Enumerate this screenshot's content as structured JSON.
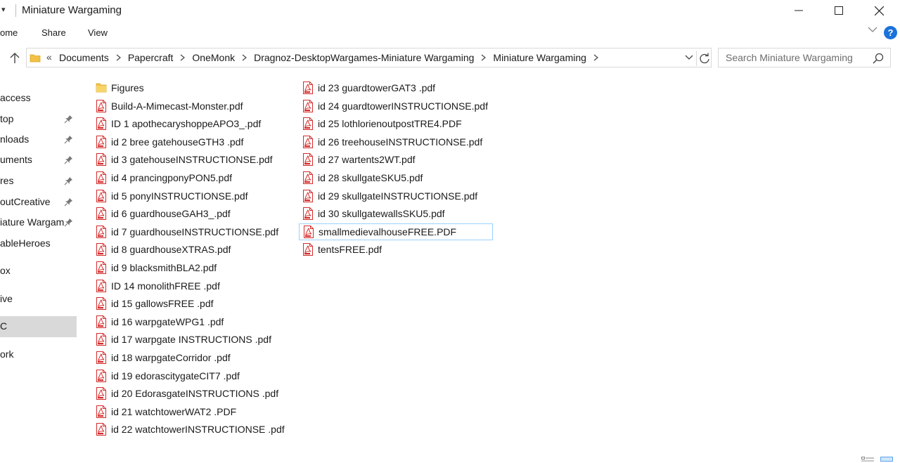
{
  "window": {
    "title": "Miniature Wargaming",
    "controls": [
      "minimize-icon",
      "maximize-icon",
      "close-icon"
    ]
  },
  "ribbon": {
    "tabs": [
      "ome",
      "Share",
      "View"
    ],
    "help_label": "?"
  },
  "address": {
    "overflow_label": "«",
    "breadcrumbs": [
      "Documents",
      "Papercraft",
      "OneMonk",
      "Dragnoz-DesktopWargames-Miniature Wargaming",
      "Miniature Wargaming"
    ]
  },
  "search": {
    "placeholder": "Search Miniature Wargaming"
  },
  "nav": {
    "items": [
      {
        "label": "access",
        "pinned": false
      },
      {
        "label": "top",
        "pinned": true
      },
      {
        "label": "nloads",
        "pinned": true
      },
      {
        "label": "uments",
        "pinned": true
      },
      {
        "label": "res",
        "pinned": true
      },
      {
        "label": "outCreative",
        "pinned": true
      },
      {
        "label": "iature Wargam",
        "pinned": true
      },
      {
        "label": "ableHeroes",
        "pinned": false
      },
      {
        "label": "ox",
        "pinned": false
      },
      {
        "label": "ive",
        "pinned": false
      },
      {
        "label": "C",
        "pinned": false,
        "selected": true
      },
      {
        "label": "ork",
        "pinned": false
      }
    ]
  },
  "files": {
    "column1": [
      {
        "name": "Figures",
        "type": "folder"
      },
      {
        "name": "Build-A-Mimecast-Monster.pdf",
        "type": "pdf"
      },
      {
        "name": "ID 1 apothecaryshoppeAPO3_.pdf",
        "type": "pdf"
      },
      {
        "name": "id 2 bree gatehouseGTH3 .pdf",
        "type": "pdf"
      },
      {
        "name": "id 3 gatehouseINSTRUCTIONSE.pdf",
        "type": "pdf"
      },
      {
        "name": "id 4 prancingponyPON5.pdf",
        "type": "pdf"
      },
      {
        "name": "id 5 ponyINSTRUCTIONSE.pdf",
        "type": "pdf"
      },
      {
        "name": "id 6 guardhouseGAH3_.pdf",
        "type": "pdf"
      },
      {
        "name": "id 7 guardhouseINSTRUCTIONSE.pdf",
        "type": "pdf"
      },
      {
        "name": "id 8 guardhouseXTRAS.pdf",
        "type": "pdf"
      },
      {
        "name": "id 9 blacksmithBLA2.pdf",
        "type": "pdf"
      },
      {
        "name": "ID 14 monolithFREE .pdf",
        "type": "pdf"
      },
      {
        "name": "id 15 gallowsFREE .pdf",
        "type": "pdf"
      },
      {
        "name": "id 16 warpgateWPG1 .pdf",
        "type": "pdf"
      },
      {
        "name": "id 17 warpgate INSTRUCTIONS .pdf",
        "type": "pdf"
      },
      {
        "name": "id 18 warpgateCorridor .pdf",
        "type": "pdf"
      },
      {
        "name": "id 19 edorascitygateCIT7 .pdf",
        "type": "pdf"
      },
      {
        "name": "id 20 EdorasgateINSTRUCTIONS .pdf",
        "type": "pdf"
      },
      {
        "name": "id 21 watchtowerWAT2 .PDF",
        "type": "pdf"
      },
      {
        "name": "id 22 watchtowerINSTRUCTIONSE .pdf",
        "type": "pdf"
      }
    ],
    "column2": [
      {
        "name": "id 23 guardtowerGAT3 .pdf",
        "type": "pdf"
      },
      {
        "name": "id 24 guardtowerINSTRUCTIONSE.pdf",
        "type": "pdf"
      },
      {
        "name": "id 25 lothlorienoutpostTRE4.PDF",
        "type": "pdf"
      },
      {
        "name": "id 26 treehouseINSTRUCTIONSE.pdf",
        "type": "pdf"
      },
      {
        "name": "id 27 wartents2WT.pdf",
        "type": "pdf"
      },
      {
        "name": "id 28 skullgateSKU5.pdf",
        "type": "pdf"
      },
      {
        "name": "id 29 skullgateINSTRUCTIONSE.pdf",
        "type": "pdf"
      },
      {
        "name": "id 30 skullgatewallsSKU5.pdf",
        "type": "pdf"
      },
      {
        "name": "smallmedievalhouseFREE.PDF",
        "type": "pdf",
        "selected": true
      },
      {
        "name": "tentsFREE.pdf",
        "type": "pdf"
      }
    ]
  },
  "colors": {
    "pdf_red": "#d42b2b",
    "folder_yellow": "#f2c145",
    "selection_border": "#99d1ff",
    "help_blue": "#1a73d9"
  }
}
